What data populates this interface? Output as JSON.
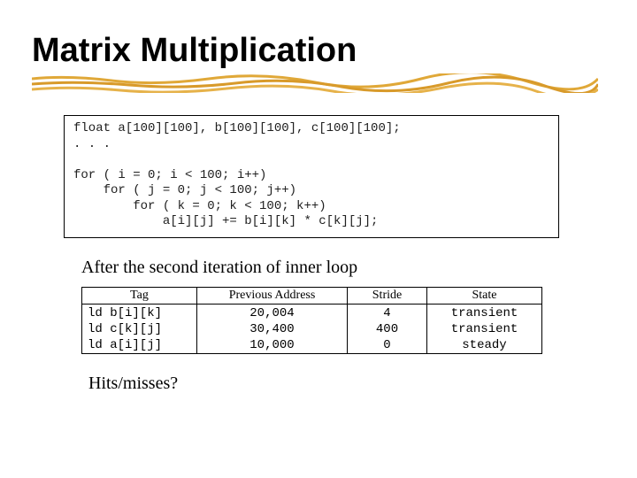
{
  "title": "Matrix Multiplication",
  "code": {
    "l1": "float a[100][100], b[100][100], c[100][100];",
    "l2": ". . .",
    "l3": "for ( i = 0; i < 100; i++)",
    "l4": "    for ( j = 0; j < 100; j++)",
    "l5": "        for ( k = 0; k < 100; k++)",
    "l6": "            a[i][j] += b[i][k] * c[k][j];"
  },
  "caption": "After the second iteration of inner loop",
  "table": {
    "headers": {
      "c1": "Tag",
      "c2": "Previous Address",
      "c3": "Stride",
      "c4": "State"
    },
    "rows": [
      {
        "tag": "ld b[i][k]",
        "addr": "20,004",
        "stride": "4",
        "state": "transient"
      },
      {
        "tag": "ld c[k][j]",
        "addr": "30,400",
        "stride": "400",
        "state": "transient"
      },
      {
        "tag": "ld a[i][j]",
        "addr": "10,000",
        "stride": "0",
        "state": "steady"
      }
    ]
  },
  "question": "Hits/misses?"
}
